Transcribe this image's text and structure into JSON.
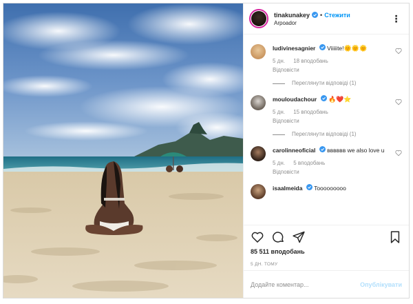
{
  "post": {
    "author": "tinakunakey",
    "follow_label": "Стежити",
    "location": "Arpoador",
    "more_icon": "more-options-icon",
    "colors": {
      "accent": "#0095f6",
      "verified": "#3897f0",
      "publish_disabled": "#b2dffc",
      "meta": "#8e8e8e"
    }
  },
  "comments": [
    {
      "user": "ludivinesagnier",
      "text": "Viiiiite!",
      "emojis": "🌞🌞🌞",
      "age": "5 дн.",
      "likes": "18 вподобань",
      "reply": "Відповісти",
      "view_replies": "Переглянути відповіді (1)"
    },
    {
      "user": "mouloudachour",
      "text": "",
      "emojis": "🔥❤️⭐",
      "age": "5 дн.",
      "likes": "15 вподобань",
      "reply": "Відповісти",
      "view_replies": "Переглянути відповіді (1)"
    },
    {
      "user": "carolinneoficial",
      "text": "вввввв we also love u",
      "emojis": "",
      "age": "5 дн.",
      "likes": "5 вподобань",
      "reply": "Відповісти",
      "view_replies": ""
    },
    {
      "user": "isaalmeida",
      "text": "Tooooooooo",
      "emojis": "",
      "age": "",
      "likes": "",
      "reply": "",
      "view_replies": ""
    }
  ],
  "actions": {
    "likes_count": "85 511 вподобань",
    "time_ago": "5 ДН. ТОМУ",
    "comment_placeholder": "Додайте коментар...",
    "publish_label": "Опублікувати"
  }
}
